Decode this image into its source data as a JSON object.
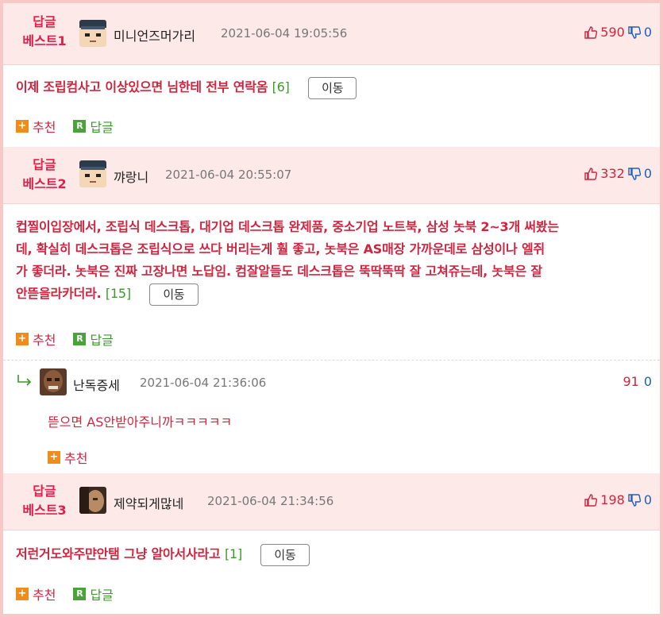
{
  "comments": [
    {
      "badge_top": "답글",
      "badge_bottom": "베스트1",
      "nick": "미니언즈머가리",
      "time": "2021-06-04 19:05:56",
      "up": "590",
      "down": "0",
      "text": "이제 조립컴사고 이상있으면 님한테 전부 연락옴",
      "reply_count": "[6]",
      "move_label": "이동",
      "recommend_label": "추천",
      "reply_label": "답글"
    },
    {
      "badge_top": "답글",
      "badge_bottom": "베스트2",
      "nick": "꺄랑니",
      "time": "2021-06-04 20:55:07",
      "up": "332",
      "down": "0",
      "lines": [
        "컵찔이입장에서, 조립식 데스크톱, 대기업 데스크톱 완제품, 중소기업 노트북, 삼성 놋북 2~3개 써봤는",
        "데, 확실히 데스크톱은 조립식으로 쓰다 버리는게 훨 좋고, 놋북은 AS매장 가까운데로 삼성이나 엘쥐",
        "가 좋더라. 놋북은 진짜 고장나면 노답임. 컴잘알들도 데스크톱은 뚝딱뚝딱 잘 고쳐쥬는데, 놋북은 잘",
        "안뜯을라카더라."
      ],
      "reply_count": "[15]",
      "move_label": "이동",
      "recommend_label": "추천",
      "reply_label": "답글",
      "reply": {
        "nick": "난독증세",
        "time": "2021-06-04 21:36:06",
        "up": "91",
        "down": "0",
        "text": "뜯으면 AS안받아주니까ㅋㅋㅋㅋㅋ",
        "recommend_label": "추천"
      }
    },
    {
      "badge_top": "답글",
      "badge_bottom": "베스트3",
      "nick": "제약되게많네",
      "time": "2021-06-04 21:34:56",
      "up": "198",
      "down": "0",
      "text": "저런거도와주먄안탬 그냥 알아서사라고",
      "reply_count": "[1]",
      "move_label": "이동",
      "recommend_label": "추천",
      "reply_label": "답글"
    }
  ],
  "colors": {
    "accent_red": "#d0243f",
    "green": "#3a9a2a",
    "orange": "#f08c1a",
    "down_blue": "#1f5fb8",
    "header_bg": "#fde9e8",
    "frame_bg": "#f6c9c7"
  },
  "icons": [
    "thumbs-up-icon",
    "thumbs-down-icon",
    "plus-icon",
    "reply-r-icon",
    "reply-arrow-icon"
  ]
}
